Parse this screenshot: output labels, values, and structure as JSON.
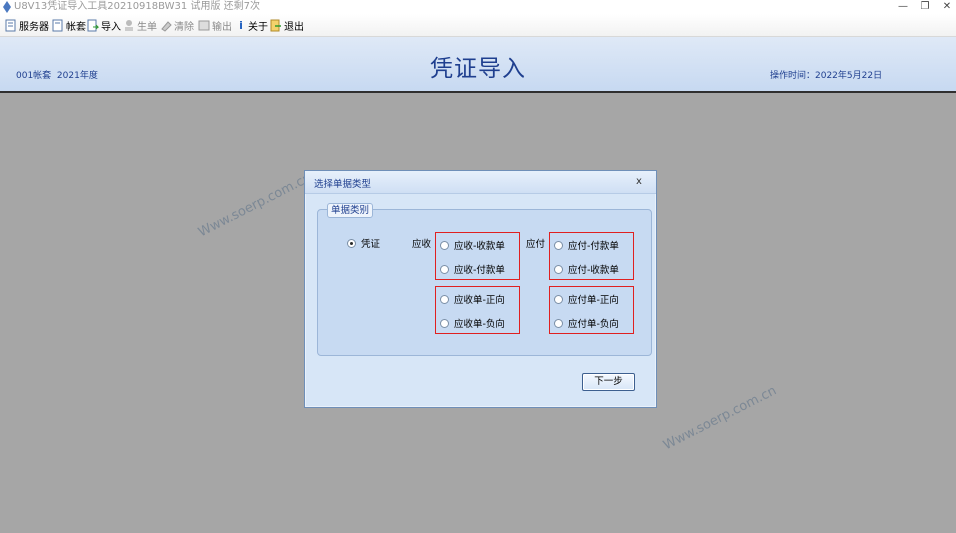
{
  "app": {
    "title": "U8V13凭证导入工具20210918BW31 试用版 还剩7次"
  },
  "toolbar": {
    "items": [
      {
        "label": "服务器",
        "icon": "server-icon",
        "enabled": true
      },
      {
        "label": "帐套",
        "icon": "book-icon",
        "enabled": true
      },
      {
        "label": "导入",
        "icon": "import-icon",
        "enabled": true
      },
      {
        "label": "生单",
        "icon": "generate-icon",
        "enabled": false
      },
      {
        "label": "清除",
        "icon": "clear-icon",
        "enabled": false
      },
      {
        "label": "输出",
        "icon": "export-icon",
        "enabled": false
      },
      {
        "label": "关于",
        "icon": "info-icon",
        "enabled": true
      },
      {
        "label": "退出",
        "icon": "exit-icon",
        "enabled": true
      }
    ]
  },
  "header": {
    "title": "凭证导入",
    "account": "001帐套",
    "year": "2021年度",
    "operation_time": "操作时间：2022年5月22日"
  },
  "dialog": {
    "title": "选择单据类型",
    "close": "x",
    "group_label": "单据类别",
    "voucher_label": "凭证",
    "receivable_label": "应收",
    "payable_label": "应付",
    "options": {
      "ar_receipt": "应收-收款单",
      "ar_payment": "应收-付款单",
      "ap_payment": "应付-付款单",
      "ap_receipt": "应付-收款单",
      "ar_bill_pos": "应收单-正向",
      "ar_bill_neg": "应收单-负向",
      "ap_bill_pos": "应付单-正向",
      "ap_bill_neg": "应付单-负向"
    },
    "next_button": "下一步"
  },
  "watermark": "Www.soerp.com.cn",
  "colors": {
    "accent": "#1f3f8f",
    "highlight_border": "#e02020",
    "background": "#a6a6a6"
  }
}
